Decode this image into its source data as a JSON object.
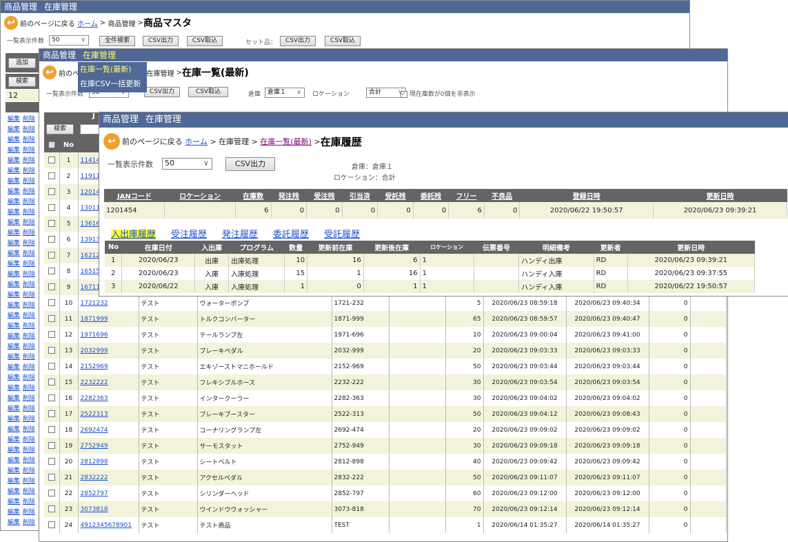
{
  "nav": {
    "product": "商品管理",
    "stock": "在庫管理"
  },
  "common": {
    "back": "前のページに戻る",
    "home": "ホーム",
    "sep": ">",
    "per_page_label": "一覧表示件数",
    "per_page": "50",
    "csv_out": "CSV出力",
    "csv_in": "CSV取込"
  },
  "back_window": {
    "crumb_mid": "商品管理",
    "title": "商品マスタ",
    "search_all": "全件検索",
    "set_label": "セット品：",
    "add": "追加",
    "search": "検索",
    "count": "12",
    "edit": "編集",
    "delete": "削除"
  },
  "menu": {
    "items": [
      "在庫一覧(最新)",
      "在庫CSV一括更新"
    ]
  },
  "mid_window": {
    "crumb_mid": "在庫管理",
    "title": "在庫一覧(最新)",
    "warehouse_label": "倉庫",
    "warehouse": "倉庫１",
    "location_label": "ロケーション",
    "location": "合計",
    "hide_zero": "現在庫数が0個を非表示",
    "search": "検索",
    "col_no": "No",
    "col_j": "J",
    "rows": [
      [
        "1",
        "11414",
        "",
        "",
        "",
        "",
        "",
        "",
        "",
        ""
      ],
      [
        "2",
        "11911",
        "",
        "",
        "",
        "",
        "",
        "",
        "",
        ""
      ],
      [
        "3",
        "12014",
        "",
        "",
        "",
        "",
        "",
        "",
        "",
        ""
      ],
      [
        "4",
        "13011",
        "",
        "",
        "",
        "",
        "",
        "",
        "",
        ""
      ],
      [
        "5",
        "13616",
        "",
        "",
        "",
        "",
        "",
        "",
        "",
        ""
      ],
      [
        "6",
        "13913",
        "",
        "",
        "",
        "",
        "",
        "",
        "",
        ""
      ],
      [
        "7",
        "16212",
        "",
        "",
        "",
        "",
        "",
        "",
        "",
        ""
      ],
      [
        "8",
        "16515",
        "",
        "",
        "",
        "",
        "",
        "",
        "",
        ""
      ],
      [
        "9",
        "16711",
        "",
        "",
        "",
        "",
        "",
        "",
        "",
        ""
      ],
      [
        "10",
        "1721232",
        "テスト",
        "ウォーターポンプ",
        "1721-232",
        "5",
        "2020/06/23 08:59:18",
        "2020/06/23 09:40:34",
        "0"
      ],
      [
        "11",
        "1871999",
        "テスト",
        "トルクコンバーター",
        "1871-999",
        "65",
        "2020/06/23 08:59:57",
        "2020/06/23 09:40:47",
        "0"
      ],
      [
        "12",
        "1971696",
        "テスト",
        "テールランプ左",
        "1971-696",
        "10",
        "2020/06/23 09:00:04",
        "2020/06/23 09:41:00",
        "0"
      ],
      [
        "13",
        "2032999",
        "テスト",
        "ブレーキペダル",
        "2032-999",
        "20",
        "2020/06/23 09:03:33",
        "2020/06/23 09:03:33",
        "0"
      ],
      [
        "14",
        "2152969",
        "テスト",
        "エキゾーストマニホールド",
        "2152-969",
        "50",
        "2020/06/23 09:03:44",
        "2020/06/23 09:03:44",
        "0"
      ],
      [
        "15",
        "2232222",
        "テスト",
        "フレキシブルホース",
        "2232-222",
        "30",
        "2020/06/23 09:03:54",
        "2020/06/23 09:03:54",
        "0"
      ],
      [
        "16",
        "2282363",
        "テスト",
        "インタークーラー",
        "2282-363",
        "30",
        "2020/06/23 09:04:02",
        "2020/06/23 09:04:02",
        "0"
      ],
      [
        "17",
        "2522313",
        "テスト",
        "ブレーキブースター",
        "2522-313",
        "50",
        "2020/06/23 09:04:12",
        "2020/06/23 09:08:43",
        "0"
      ],
      [
        "18",
        "2692474",
        "テスト",
        "コーナリングランプ左",
        "2692-474",
        "20",
        "2020/06/23 09:09:02",
        "2020/06/23 09:09:02",
        "0"
      ],
      [
        "19",
        "2752949",
        "テスト",
        "サーモスタット",
        "2752-949",
        "30",
        "2020/06/23 09:09:18",
        "2020/06/23 09:09:18",
        "0"
      ],
      [
        "20",
        "2812898",
        "テスト",
        "シートベルト",
        "2812-898",
        "40",
        "2020/06/23 09:09:42",
        "2020/06/23 09:09:42",
        "0"
      ],
      [
        "21",
        "2832222",
        "テスト",
        "アクセルペダル",
        "2832-222",
        "50",
        "2020/06/23 09:11:07",
        "2020/06/23 09:11:07",
        "0"
      ],
      [
        "22",
        "2852797",
        "テスト",
        "シリンダーヘッド",
        "2852-797",
        "60",
        "2020/06/23 09:12:00",
        "2020/06/23 09:12:00",
        "0"
      ],
      [
        "23",
        "3073818",
        "テスト",
        "ウインドウウォッシャー",
        "3073-818",
        "70",
        "2020/06/23 09:12:14",
        "2020/06/23 09:12:14",
        "0"
      ],
      [
        "24",
        "4912345678901",
        "テスト",
        "テスト商品",
        "TEST",
        "1",
        "2020/06/14 01:35:27",
        "2020/06/14 01:35:27",
        "0"
      ]
    ]
  },
  "front_window": {
    "crumb_mid": "在庫管理",
    "crumb_link": "在庫一覧(最新)",
    "title": "在庫履歴",
    "warehouse_text": "倉庫：倉庫１",
    "location_text": "ロケーション：合計",
    "summary_headers": [
      "JANコード",
      "ロケーション",
      "在庫数",
      "発注残",
      "受注残",
      "引当済",
      "受託残",
      "委託残",
      "フリー",
      "不良品",
      "登録日時",
      "更新日時"
    ],
    "summary_row": [
      "1201454",
      "",
      "6",
      "0",
      "0",
      "0",
      "0",
      "0",
      "6",
      "0",
      "2020/06/22 19:50:57",
      "2020/06/23 09:39:21"
    ],
    "tabs": [
      "入出庫履歴",
      "受注履歴",
      "発注履歴",
      "委託履歴",
      "受託履歴"
    ],
    "history_headers": [
      "No",
      "在庫日付",
      "入出庫",
      "プログラム",
      "数量",
      "更新前在庫",
      "更新後在庫",
      "ロケーション",
      "伝票番号",
      "明細備考",
      "更新者",
      "更新日時"
    ],
    "history_rows": [
      [
        "1",
        "2020/06/23",
        "出庫",
        "出庫処理",
        "10",
        "16",
        "6",
        "1",
        "",
        "ハンディ出庫",
        "RD",
        "2020/06/23 09:39:21"
      ],
      [
        "2",
        "2020/06/23",
        "入庫",
        "入庫処理",
        "15",
        "1",
        "16",
        "1",
        "",
        "ハンディ入庫",
        "RD",
        "2020/06/23 09:37:55"
      ],
      [
        "3",
        "2020/06/22",
        "入庫",
        "入庫処理",
        "1",
        "0",
        "1",
        "1",
        "",
        "ハンディ入庫",
        "RD",
        "2020/06/22 19:50:57"
      ]
    ]
  },
  "colors": {
    "header": "#506896",
    "menu_active": "#ffff66",
    "table_header": "#646464",
    "row_alt": "#f3f3dc",
    "tab_highlight": "#ffff33"
  }
}
